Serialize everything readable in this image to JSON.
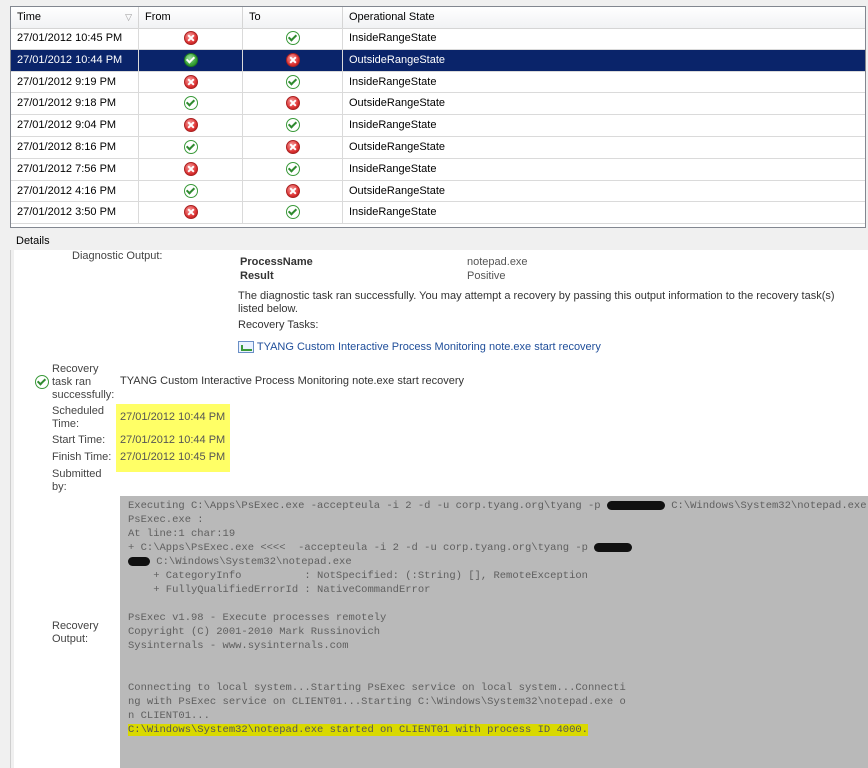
{
  "grid": {
    "columns": {
      "time": "Time",
      "from": "From",
      "to": "To",
      "state": "Operational State"
    },
    "rows": [
      {
        "time": "27/01/2012 10:45 PM",
        "from": "error",
        "to": "healthy",
        "state": "InsideRangeState",
        "selected": false
      },
      {
        "time": "27/01/2012 10:44 PM",
        "from": "healthy",
        "to": "error",
        "state": "OutsideRangeState",
        "selected": true
      },
      {
        "time": "27/01/2012 9:19 PM",
        "from": "error",
        "to": "healthy",
        "state": "InsideRangeState",
        "selected": false
      },
      {
        "time": "27/01/2012 9:18 PM",
        "from": "healthy",
        "to": "error",
        "state": "OutsideRangeState",
        "selected": false
      },
      {
        "time": "27/01/2012 9:04 PM",
        "from": "error",
        "to": "healthy",
        "state": "InsideRangeState",
        "selected": false
      },
      {
        "time": "27/01/2012 8:16 PM",
        "from": "healthy",
        "to": "error",
        "state": "OutsideRangeState",
        "selected": false
      },
      {
        "time": "27/01/2012 7:56 PM",
        "from": "error",
        "to": "healthy",
        "state": "InsideRangeState",
        "selected": false
      },
      {
        "time": "27/01/2012 4:16 PM",
        "from": "healthy",
        "to": "error",
        "state": "OutsideRangeState",
        "selected": false
      },
      {
        "time": "27/01/2012 3:50 PM",
        "from": "error",
        "to": "healthy",
        "state": "InsideRangeState",
        "selected": false
      }
    ]
  },
  "details": {
    "header": "Details",
    "diagnostic_label": "Diagnostic Output:",
    "process_name_key": "ProcessName",
    "process_name_value": "notepad.exe",
    "result_key": "Result",
    "result_value": "Positive",
    "diag_message": "The diagnostic task ran successfully. You may attempt a recovery by passing this output information to the recovery task(s) listed below.",
    "recovery_tasks_label": "Recovery Tasks:",
    "recovery_task_link": "TYANG Custom Interactive Process Monitoring note.exe start recovery",
    "recovery_status_label": "Recovery task ran successfully:",
    "recovery_status_value": "TYANG Custom Interactive Process Monitoring note.exe start recovery",
    "scheduled_label": "Scheduled Time:",
    "scheduled_value": "27/01/2012 10:44 PM",
    "start_label": "Start Time:",
    "start_value": "27/01/2012 10:44 PM",
    "finish_label": "Finish Time:",
    "finish_value": "27/01/2012 10:45 PM",
    "submitted_label": "Submitted by:",
    "recovery_output_label": "Recovery Output:"
  },
  "console": {
    "line1": "Executing C:\\Apps\\PsExec.exe -accepteula -i 2 -d -u corp.tyang.org\\tyang -p ",
    "line1_tail": " C:\\Windows\\System32\\notepad.exe",
    "line2": "PsExec.exe :",
    "line3": "At line:1 char:19",
    "line4": "+ C:\\Apps\\PsExec.exe <<<<  -accepteula -i 2 -d -u corp.tyang.org\\tyang -p ",
    "line5": " C:\\Windows\\System32\\notepad.exe",
    "line6": "    + CategoryInfo          : NotSpecified: (:String) [], RemoteException",
    "line7": "    + FullyQualifiedErrorId : NativeCommandError",
    "line8": "PsExec v1.98 - Execute processes remotely",
    "line9": "Copyright (C) 2001-2010 Mark Russinovich",
    "line10": "Sysinternals - www.sysinternals.com",
    "line11": "Connecting to local system...Starting PsExec service on local system...Connecti",
    "line12": "ng with PsExec service on CLIENT01...Starting C:\\Windows\\System32\\notepad.exe o",
    "line13": "n CLIENT01...",
    "line14": "C:\\Windows\\System32\\notepad.exe started on CLIENT01 with process ID 4000."
  }
}
